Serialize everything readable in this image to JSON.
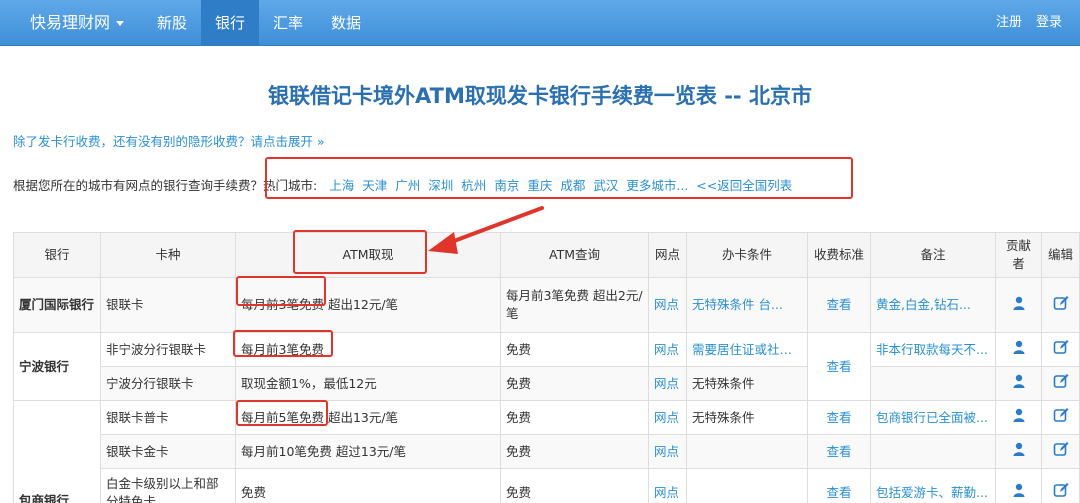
{
  "nav": {
    "brand": "快易理财网",
    "items": [
      "新股",
      "银行",
      "汇率",
      "数据"
    ],
    "active": "银行",
    "register": "注册",
    "login": "登录"
  },
  "page_title": "银联借记卡境外ATM取现发卡银行手续费一览表 -- 北京市",
  "expand_link": "除了发卡行收费，还有没有别的隐形收费？请点击展开 »",
  "city_row": {
    "prompt": "根据您所在的城市有网点的银行查询手续费？",
    "hot_label": "热门城市:",
    "cities": [
      "上海",
      "天津",
      "广州",
      "深圳",
      "杭州",
      "南京",
      "重庆",
      "成都",
      "武汉",
      "更多城市...",
      "<<返回全国列表"
    ]
  },
  "table": {
    "headers": [
      "银行",
      "卡种",
      "ATM取现",
      "ATM查询",
      "网点",
      "办卡条件",
      "收费标准",
      "备注",
      "贡献者",
      "编辑"
    ],
    "rows": [
      {
        "bank": "厦门国际银行",
        "card": "银联卡",
        "atm_free": "每月前3笔免费",
        "atm_rest": " 超出12元/笔",
        "query": "每月前3笔免费 超出2元/笔",
        "outlet": "网点",
        "cond": "无特殊条件 台...",
        "fee": "查看",
        "note": "黄金,白金,钻石..."
      },
      {
        "bank": "宁波银行",
        "card": "非宁波分行银联卡",
        "atm_free": "每月前3笔免费",
        "atm_rest": "",
        "query": "免费",
        "outlet": "网点",
        "cond": "需要居住证或社保...",
        "fee": "查看",
        "note": "非本行取款每天不..."
      },
      {
        "bank": "",
        "card": "宁波分行银联卡",
        "atm_free": "",
        "atm_rest": "取现金额1%，最低12元",
        "query": "免费",
        "outlet": "网点",
        "cond": "无特殊条件",
        "fee": "",
        "note": ""
      },
      {
        "bank": "包商银行",
        "card": "银联卡普卡",
        "atm_free": "每月前5笔免费",
        "atm_rest": " 超出13元/笔",
        "query": "免费",
        "outlet": "网点",
        "cond": "无特殊条件",
        "fee": "查看",
        "note": "包商银行已全面被..."
      },
      {
        "bank": "",
        "card": "银联卡金卡",
        "atm_free": "",
        "atm_rest": "每月前10笔免费 超过13元/笔",
        "query": "免费",
        "outlet": "网点",
        "cond": "",
        "fee": "查看",
        "note": ""
      },
      {
        "bank": "",
        "card": "白金卡级别以上和部分特色卡",
        "atm_free": "",
        "atm_rest": "免费",
        "query": "免费",
        "outlet": "网点",
        "cond": "",
        "fee": "查看",
        "note": "包括爱游卡、薪勤..."
      }
    ]
  },
  "icons": {
    "user": "user-icon",
    "edit": "edit-icon",
    "arrow": "red-arrow-annotation"
  },
  "colors": {
    "nav": "#3f8fd8",
    "link": "#2a8fd0",
    "title": "#2a6fb0",
    "annotation": "#e0352b"
  }
}
